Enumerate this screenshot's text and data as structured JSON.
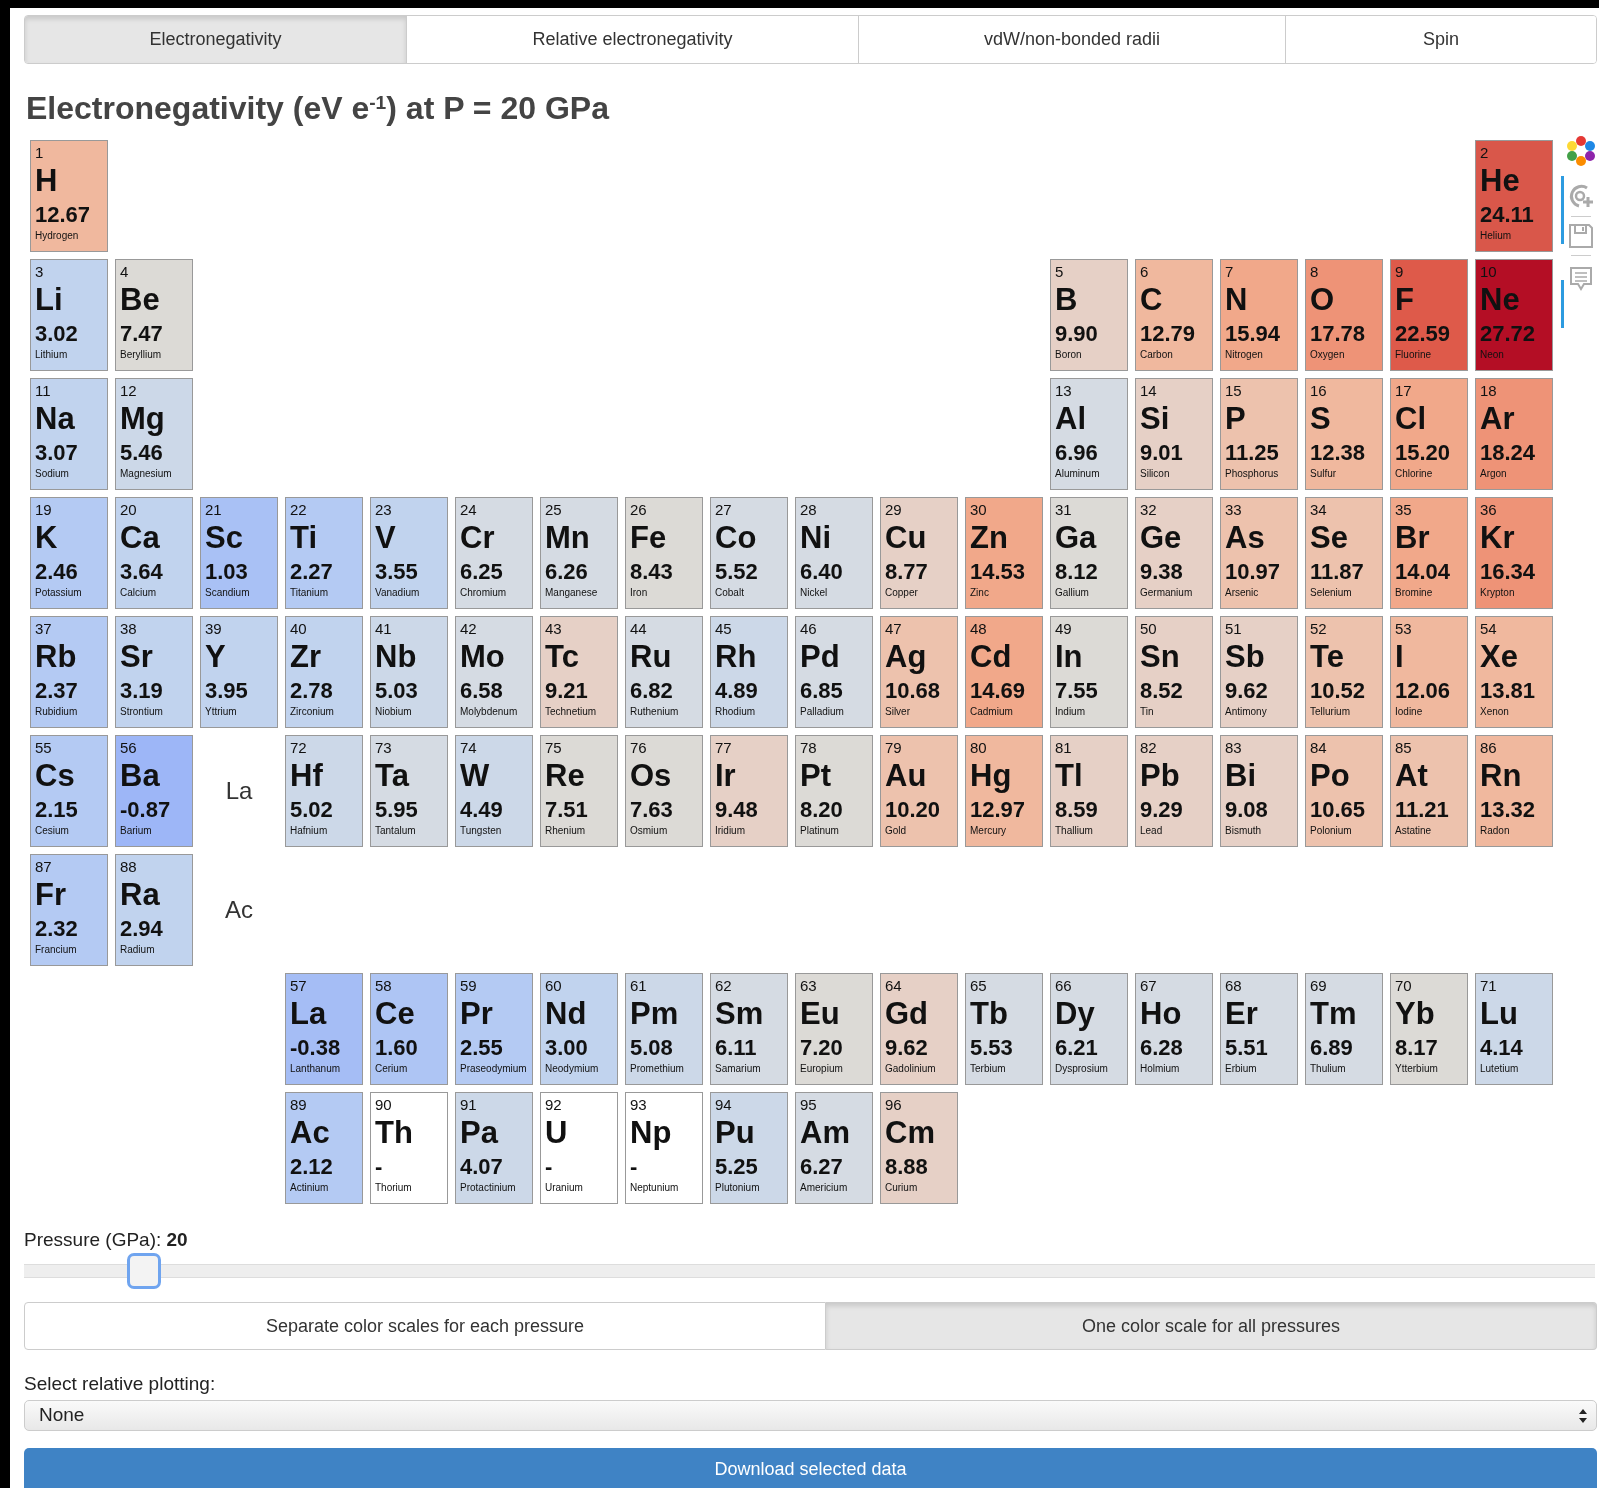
{
  "tabs": [
    {
      "label": "Electronegativity",
      "selected": true
    },
    {
      "label": "Relative electronegativity",
      "selected": false
    },
    {
      "label": "vdW/non-bonded radii",
      "selected": false
    },
    {
      "label": "Spin",
      "selected": false
    }
  ],
  "heading": "Electronegativity (eV e$^{-1}$) at P = 20 GPa",
  "periods": [
    {
      "elements": [
        {
          "number": "1",
          "symbol": "H",
          "value": "12.67",
          "name": "Hydrogen",
          "color": "#f0b89e"
        },
        {
          "number": "2",
          "symbol": "He",
          "value": "24.11",
          "name": "Helium",
          "color": "#d9574a"
        }
      ]
    },
    {
      "elements": [
        {
          "number": "3",
          "symbol": "Li",
          "value": "3.02",
          "name": "Lithium",
          "color": "#c1d3ee"
        },
        {
          "number": "4",
          "symbol": "Be",
          "value": "7.47",
          "name": "Beryllium",
          "color": "#dcdad6"
        },
        {
          "number": "5",
          "symbol": "B",
          "value": "9.90",
          "name": "Boron",
          "color": "#e6d0c6"
        },
        {
          "number": "6",
          "symbol": "C",
          "value": "12.79",
          "name": "Carbon",
          "color": "#f0b89e"
        },
        {
          "number": "7",
          "symbol": "N",
          "value": "15.94",
          "name": "Nitrogen",
          "color": "#f1a88a"
        },
        {
          "number": "8",
          "symbol": "O",
          "value": "17.78",
          "name": "Oxygen",
          "color": "#ee9377"
        },
        {
          "number": "9",
          "symbol": "F",
          "value": "22.59",
          "name": "Fluorine",
          "color": "#de5a4a"
        },
        {
          "number": "10",
          "symbol": "Ne",
          "value": "27.72",
          "name": "Neon",
          "color": "#b40e25"
        }
      ]
    },
    {
      "elements": [
        {
          "number": "11",
          "symbol": "Na",
          "value": "3.07",
          "name": "Sodium",
          "color": "#c1d3ee"
        },
        {
          "number": "12",
          "symbol": "Mg",
          "value": "5.46",
          "name": "Magnesium",
          "color": "#ccd8e8"
        },
        {
          "number": "13",
          "symbol": "Al",
          "value": "6.96",
          "name": "Aluminum",
          "color": "#d5dbe3"
        },
        {
          "number": "14",
          "symbol": "Si",
          "value": "9.01",
          "name": "Silicon",
          "color": "#e6d0c6"
        },
        {
          "number": "15",
          "symbol": "P",
          "value": "11.25",
          "name": "Phosphorus",
          "color": "#edc2ad"
        },
        {
          "number": "16",
          "symbol": "S",
          "value": "12.38",
          "name": "Sulfur",
          "color": "#f0b89e"
        },
        {
          "number": "17",
          "symbol": "Cl",
          "value": "15.20",
          "name": "Chlorine",
          "color": "#f1a88a"
        },
        {
          "number": "18",
          "symbol": "Ar",
          "value": "18.24",
          "name": "Argon",
          "color": "#ee9377"
        }
      ]
    },
    {
      "elements": [
        {
          "number": "19",
          "symbol": "K",
          "value": "2.46",
          "name": "Potassium",
          "color": "#b4caf3"
        },
        {
          "number": "20",
          "symbol": "Ca",
          "value": "3.64",
          "name": "Calcium",
          "color": "#c1d3ee"
        },
        {
          "number": "21",
          "symbol": "Sc",
          "value": "1.03",
          "name": "Scandium",
          "color": "#a9c1f5"
        },
        {
          "number": "22",
          "symbol": "Ti",
          "value": "2.27",
          "name": "Titanium",
          "color": "#b4caf3"
        },
        {
          "number": "23",
          "symbol": "V",
          "value": "3.55",
          "name": "Vanadium",
          "color": "#c1d3ee"
        },
        {
          "number": "24",
          "symbol": "Cr",
          "value": "6.25",
          "name": "Chromium",
          "color": "#d5dbe3"
        },
        {
          "number": "25",
          "symbol": "Mn",
          "value": "6.26",
          "name": "Manganese",
          "color": "#d5dbe3"
        },
        {
          "number": "26",
          "symbol": "Fe",
          "value": "8.43",
          "name": "Iron",
          "color": "#dcdad6"
        },
        {
          "number": "27",
          "symbol": "Co",
          "value": "5.52",
          "name": "Cobalt",
          "color": "#d5dbe3"
        },
        {
          "number": "28",
          "symbol": "Ni",
          "value": "6.40",
          "name": "Nickel",
          "color": "#d5dbe3"
        },
        {
          "number": "29",
          "symbol": "Cu",
          "value": "8.77",
          "name": "Copper",
          "color": "#e6d0c6"
        },
        {
          "number": "30",
          "symbol": "Zn",
          "value": "14.53",
          "name": "Zinc",
          "color": "#f1a88a"
        },
        {
          "number": "31",
          "symbol": "Ga",
          "value": "8.12",
          "name": "Gallium",
          "color": "#dcdad6"
        },
        {
          "number": "32",
          "symbol": "Ge",
          "value": "9.38",
          "name": "Germanium",
          "color": "#e6d0c6"
        },
        {
          "number": "33",
          "symbol": "As",
          "value": "10.97",
          "name": "Arsenic",
          "color": "#edc2ad"
        },
        {
          "number": "34",
          "symbol": "Se",
          "value": "11.87",
          "name": "Selenium",
          "color": "#edc2ad"
        },
        {
          "number": "35",
          "symbol": "Br",
          "value": "14.04",
          "name": "Bromine",
          "color": "#f1a88a"
        },
        {
          "number": "36",
          "symbol": "Kr",
          "value": "16.34",
          "name": "Krypton",
          "color": "#ee9377"
        }
      ]
    },
    {
      "elements": [
        {
          "number": "37",
          "symbol": "Rb",
          "value": "2.37",
          "name": "Rubidium",
          "color": "#b4caf3"
        },
        {
          "number": "38",
          "symbol": "Sr",
          "value": "3.19",
          "name": "Strontium",
          "color": "#c1d3ee"
        },
        {
          "number": "39",
          "symbol": "Y",
          "value": "3.95",
          "name": "Yttrium",
          "color": "#c1d3ee"
        },
        {
          "number": "40",
          "symbol": "Zr",
          "value": "2.78",
          "name": "Zirconium",
          "color": "#c1d3ee"
        },
        {
          "number": "41",
          "symbol": "Nb",
          "value": "5.03",
          "name": "Niobium",
          "color": "#ccd8e8"
        },
        {
          "number": "42",
          "symbol": "Mo",
          "value": "6.58",
          "name": "Molybdenum",
          "color": "#d5dbe3"
        },
        {
          "number": "43",
          "symbol": "Tc",
          "value": "9.21",
          "name": "Technetium",
          "color": "#e6d0c6"
        },
        {
          "number": "44",
          "symbol": "Ru",
          "value": "6.82",
          "name": "Ruthenium",
          "color": "#d5dbe3"
        },
        {
          "number": "45",
          "symbol": "Rh",
          "value": "4.89",
          "name": "Rhodium",
          "color": "#ccd8e8"
        },
        {
          "number": "46",
          "symbol": "Pd",
          "value": "6.85",
          "name": "Palladium",
          "color": "#d5dbe3"
        },
        {
          "number": "47",
          "symbol": "Ag",
          "value": "10.68",
          "name": "Silver",
          "color": "#edc2ad"
        },
        {
          "number": "48",
          "symbol": "Cd",
          "value": "14.69",
          "name": "Cadmium",
          "color": "#f1a88a"
        },
        {
          "number": "49",
          "symbol": "In",
          "value": "7.55",
          "name": "Indium",
          "color": "#dcdad6"
        },
        {
          "number": "50",
          "symbol": "Sn",
          "value": "8.52",
          "name": "Tin",
          "color": "#e6d0c6"
        },
        {
          "number": "51",
          "symbol": "Sb",
          "value": "9.62",
          "name": "Antimony",
          "color": "#e6d0c6"
        },
        {
          "number": "52",
          "symbol": "Te",
          "value": "10.52",
          "name": "Tellurium",
          "color": "#edc2ad"
        },
        {
          "number": "53",
          "symbol": "I",
          "value": "12.06",
          "name": "Iodine",
          "color": "#f0b89e"
        },
        {
          "number": "54",
          "symbol": "Xe",
          "value": "13.81",
          "name": "Xenon",
          "color": "#f0b89e"
        }
      ]
    },
    {
      "series_label": "La",
      "elements": [
        {
          "number": "55",
          "symbol": "Cs",
          "value": "2.15",
          "name": "Cesium",
          "color": "#b4caf3"
        },
        {
          "number": "56",
          "symbol": "Ba",
          "value": "-0.87",
          "name": "Barium",
          "color": "#9db6f7"
        },
        {
          "number": "72",
          "symbol": "Hf",
          "value": "5.02",
          "name": "Hafnium",
          "color": "#ccd8e8"
        },
        {
          "number": "73",
          "symbol": "Ta",
          "value": "5.95",
          "name": "Tantalum",
          "color": "#d5dbe3"
        },
        {
          "number": "74",
          "symbol": "W",
          "value": "4.49",
          "name": "Tungsten",
          "color": "#ccd8e8"
        },
        {
          "number": "75",
          "symbol": "Re",
          "value": "7.51",
          "name": "Rhenium",
          "color": "#dcdad6"
        },
        {
          "number": "76",
          "symbol": "Os",
          "value": "7.63",
          "name": "Osmium",
          "color": "#dcdad6"
        },
        {
          "number": "77",
          "symbol": "Ir",
          "value": "9.48",
          "name": "Iridium",
          "color": "#e6d0c6"
        },
        {
          "number": "78",
          "symbol": "Pt",
          "value": "8.20",
          "name": "Platinum",
          "color": "#dcdad6"
        },
        {
          "number": "79",
          "symbol": "Au",
          "value": "10.20",
          "name": "Gold",
          "color": "#edc2ad"
        },
        {
          "number": "80",
          "symbol": "Hg",
          "value": "12.97",
          "name": "Mercury",
          "color": "#f0b89e"
        },
        {
          "number": "81",
          "symbol": "Tl",
          "value": "8.59",
          "name": "Thallium",
          "color": "#e6d0c6"
        },
        {
          "number": "82",
          "symbol": "Pb",
          "value": "9.29",
          "name": "Lead",
          "color": "#e6d0c6"
        },
        {
          "number": "83",
          "symbol": "Bi",
          "value": "9.08",
          "name": "Bismuth",
          "color": "#e6d0c6"
        },
        {
          "number": "84",
          "symbol": "Po",
          "value": "10.65",
          "name": "Polonium",
          "color": "#edc2ad"
        },
        {
          "number": "85",
          "symbol": "At",
          "value": "11.21",
          "name": "Astatine",
          "color": "#edc2ad"
        },
        {
          "number": "86",
          "symbol": "Rn",
          "value": "13.32",
          "name": "Radon",
          "color": "#f0b89e"
        }
      ]
    },
    {
      "series_label": "Ac",
      "elements": [
        {
          "number": "87",
          "symbol": "Fr",
          "value": "2.32",
          "name": "Francium",
          "color": "#b4caf3"
        },
        {
          "number": "88",
          "symbol": "Ra",
          "value": "2.94",
          "name": "Radium",
          "color": "#c1d3ee"
        }
      ]
    }
  ],
  "f_block": [
    {
      "elements": [
        {
          "number": "57",
          "symbol": "La",
          "value": "-0.38",
          "name": "Lanthanum",
          "color": "#a5bdf5"
        },
        {
          "number": "58",
          "symbol": "Ce",
          "value": "1.60",
          "name": "Cerium",
          "color": "#aec5f4"
        },
        {
          "number": "59",
          "symbol": "Pr",
          "value": "2.55",
          "name": "Praseodymium",
          "color": "#b4caf3"
        },
        {
          "number": "60",
          "symbol": "Nd",
          "value": "3.00",
          "name": "Neodymium",
          "color": "#c1d3ee"
        },
        {
          "number": "61",
          "symbol": "Pm",
          "value": "5.08",
          "name": "Promethium",
          "color": "#ccd8e8"
        },
        {
          "number": "62",
          "symbol": "Sm",
          "value": "6.11",
          "name": "Samarium",
          "color": "#d5dbe3"
        },
        {
          "number": "63",
          "symbol": "Eu",
          "value": "7.20",
          "name": "Europium",
          "color": "#dcdad6"
        },
        {
          "number": "64",
          "symbol": "Gd",
          "value": "9.62",
          "name": "Gadolinium",
          "color": "#e6d0c6"
        },
        {
          "number": "65",
          "symbol": "Tb",
          "value": "5.53",
          "name": "Terbium",
          "color": "#d5dbe3"
        },
        {
          "number": "66",
          "symbol": "Dy",
          "value": "6.21",
          "name": "Dysprosium",
          "color": "#d5dbe3"
        },
        {
          "number": "67",
          "symbol": "Ho",
          "value": "6.28",
          "name": "Holmium",
          "color": "#d5dbe3"
        },
        {
          "number": "68",
          "symbol": "Er",
          "value": "5.51",
          "name": "Erbium",
          "color": "#d5dbe3"
        },
        {
          "number": "69",
          "symbol": "Tm",
          "value": "6.89",
          "name": "Thulium",
          "color": "#d5dbe3"
        },
        {
          "number": "70",
          "symbol": "Yb",
          "value": "8.17",
          "name": "Ytterbium",
          "color": "#dcdad6"
        },
        {
          "number": "71",
          "symbol": "Lu",
          "value": "4.14",
          "name": "Lutetium",
          "color": "#ccd8e8"
        }
      ]
    },
    {
      "elements": [
        {
          "number": "89",
          "symbol": "Ac",
          "value": "2.12",
          "name": "Actinium",
          "color": "#b4caf3"
        },
        {
          "number": "90",
          "symbol": "Th",
          "value": "-",
          "name": "Thorium",
          "color": "#ffffff"
        },
        {
          "number": "91",
          "symbol": "Pa",
          "value": "4.07",
          "name": "Protactinium",
          "color": "#ccd8e8"
        },
        {
          "number": "92",
          "symbol": "U",
          "value": "-",
          "name": "Uranium",
          "color": "#ffffff"
        },
        {
          "number": "93",
          "symbol": "Np",
          "value": "-",
          "name": "Neptunium",
          "color": "#ffffff"
        },
        {
          "number": "94",
          "symbol": "Pu",
          "value": "5.25",
          "name": "Plutonium",
          "color": "#ccd8e8"
        },
        {
          "number": "95",
          "symbol": "Am",
          "value": "6.27",
          "name": "Americium",
          "color": "#d5dbe3"
        },
        {
          "number": "96",
          "symbol": "Cm",
          "value": "8.88",
          "name": "Curium",
          "color": "#e6d0c6"
        }
      ]
    }
  ],
  "pressure": {
    "label": "Pressure (GPa): **20**",
    "level": 0.067
  },
  "scale_options": [
    {
      "label": "Separate color scales for each pressure",
      "selected": false
    },
    {
      "label": "One color scale for all pressures",
      "selected": true
    }
  ],
  "relative_plotting": {
    "label": "Select relative plotting:",
    "value": "None"
  },
  "download_button": "Download selected data"
}
